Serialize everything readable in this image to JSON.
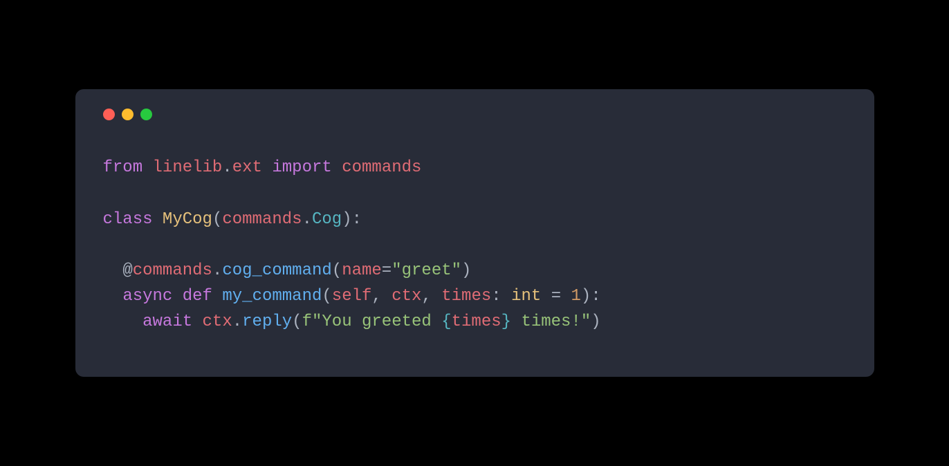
{
  "code": {
    "line1": {
      "from": "from",
      "module1": "linelib",
      "dot1": ".",
      "module2": "ext",
      "import": "import",
      "name": "commands"
    },
    "line3": {
      "class": "class",
      "classname": "MyCog",
      "paren_open": "(",
      "base1": "commands",
      "dot": ".",
      "base2": "Cog",
      "paren_close": "):"
    },
    "line5": {
      "indent": "  ",
      "at": "@",
      "decorator1": "commands",
      "dot": ".",
      "decorator2": "cog_command",
      "paren_open": "(",
      "kwarg": "name",
      "eq": "=",
      "string": "\"greet\"",
      "paren_close": ")"
    },
    "line6": {
      "indent": "  ",
      "async": "async",
      "def": "def",
      "funcname": "my_command",
      "paren_open": "(",
      "self": "self",
      "comma1": ", ",
      "ctx": "ctx",
      "comma2": ", ",
      "param": "times",
      "colon": ": ",
      "type": "int",
      "eq": " = ",
      "default": "1",
      "paren_close": "):"
    },
    "line7": {
      "indent": "    ",
      "await": "await",
      "space": " ",
      "obj": "ctx",
      "dot": ".",
      "method": "reply",
      "paren_open": "(",
      "fprefix": "f",
      "str1": "\"You greeted ",
      "brace_open": "{",
      "var": "times",
      "brace_close": "}",
      "str2": " times!\"",
      "paren_close": ")"
    }
  }
}
